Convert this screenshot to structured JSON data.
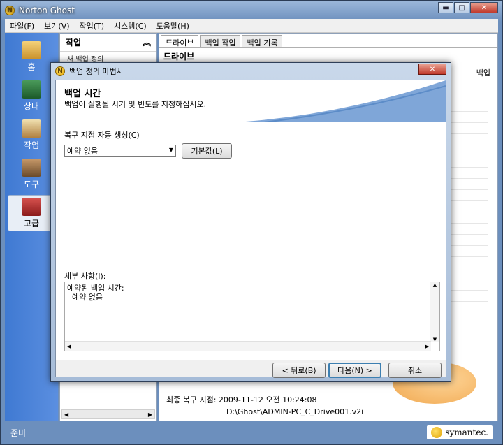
{
  "app": {
    "title": "Norton Ghost",
    "window_buttons": {
      "min": "▬",
      "max": "□",
      "close": "✕"
    }
  },
  "menu": [
    "파일(F)",
    "보기(V)",
    "작업(T)",
    "시스템(C)",
    "도움말(H)"
  ],
  "nav": [
    {
      "label": "홈",
      "icon": "home-icon"
    },
    {
      "label": "상태",
      "icon": "status-icon"
    },
    {
      "label": "작업",
      "icon": "tasks-icon"
    },
    {
      "label": "도구",
      "icon": "tools-icon"
    },
    {
      "label": "고급",
      "icon": "advanced-icon"
    }
  ],
  "task_panel": {
    "title": "작업",
    "collapse": "︽",
    "sub": "새 백업 정의"
  },
  "content": {
    "tabs": [
      "드라이브",
      "백업 작업",
      "백업 기록"
    ],
    "heading": "드라이브",
    "col_header": "백업",
    "last_restore_label": "최종 복구 지점:",
    "last_restore_time": "2009-11-12 오전 10:24:08",
    "last_restore_path": "D:\\Ghost\\ADMIN-PC_C_Drive001.v2i"
  },
  "status": {
    "text": "준비",
    "brand": "symantec."
  },
  "dialog": {
    "title": "백업 정의 마법사",
    "close": "✕",
    "header_title": "백업 시간",
    "header_sub": "백업이 실행될 시기 및 빈도를 지정하십시오.",
    "auto_label": "복구 지점 자동 생성(C)",
    "select_value": "예약 없음",
    "default_btn": "기본값(L)",
    "detail_label": "세부 사항(I):",
    "detail_text": "예약된 백업 시간:\n  예약 없음",
    "back": "< 뒤로(B)",
    "next": "다음(N) >",
    "cancel": "취소"
  }
}
